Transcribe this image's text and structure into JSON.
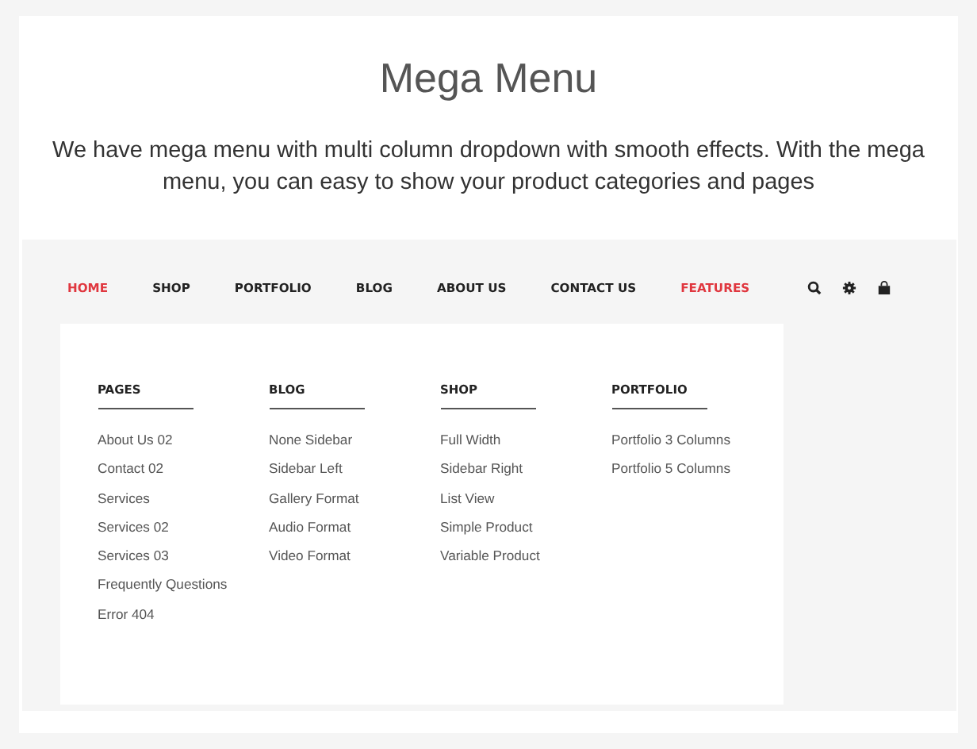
{
  "title": "Mega Menu",
  "description": "We have mega menu with multi column dropdown with smooth effects. With the mega menu, you can easy to show your product categories and pages",
  "nav": {
    "items": [
      {
        "label": "HOME",
        "highlighted": true
      },
      {
        "label": "SHOP",
        "highlighted": false
      },
      {
        "label": "PORTFOLIO",
        "highlighted": false
      },
      {
        "label": "BLOG",
        "highlighted": false
      },
      {
        "label": "ABOUT US",
        "highlighted": false
      },
      {
        "label": "CONTACT US",
        "highlighted": false
      },
      {
        "label": "FEATURES",
        "highlighted": true
      }
    ],
    "icons": [
      {
        "kind": "search"
      },
      {
        "kind": "gear"
      },
      {
        "kind": "bag"
      }
    ]
  },
  "mega_menu": {
    "columns": [
      {
        "heading": "PAGES",
        "links": [
          "About Us 02",
          "Contact 02",
          "Services",
          "Services 02",
          "Services 03",
          "Frequently Questions",
          "Error 404"
        ]
      },
      {
        "heading": "BLOG",
        "links": [
          "None Sidebar",
          "Sidebar Left",
          "Gallery Format",
          "Audio Format",
          "Video Format"
        ]
      },
      {
        "heading": "SHOP",
        "links": [
          "Full Width",
          "Sidebar Right",
          "List View",
          "Simple Product",
          "Variable Product"
        ]
      },
      {
        "heading": "PORTFOLIO",
        "links": [
          "Portfolio 3 Columns",
          "Portfolio 5 Columns"
        ]
      }
    ]
  }
}
